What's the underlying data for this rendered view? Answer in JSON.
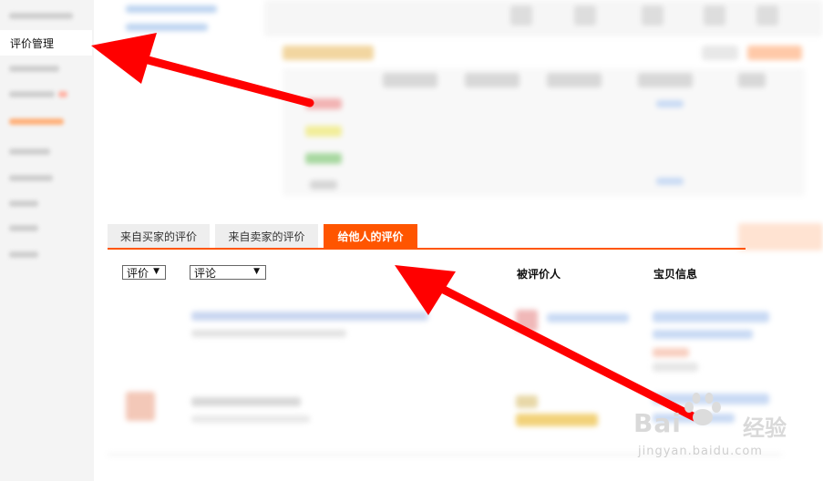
{
  "sidebar": {
    "active_item_label": "评价管理"
  },
  "tabs": [
    {
      "label": "来自买家的评价",
      "active": false
    },
    {
      "label": "来自卖家的评价",
      "active": false
    },
    {
      "label": "给他人的评价",
      "active": true
    }
  ],
  "filters": {
    "rating_select": "评价",
    "comment_select": "评论"
  },
  "columns": {
    "rated_person": "被评价人",
    "item_info": "宝贝信息"
  },
  "watermark": {
    "brand": "Bai",
    "brand_suffix": "经验",
    "url": "jingyan.baidu.com"
  },
  "colors": {
    "accent": "#ff5500",
    "arrow": "#ff0000",
    "tab_inactive": "#eeeeee"
  }
}
